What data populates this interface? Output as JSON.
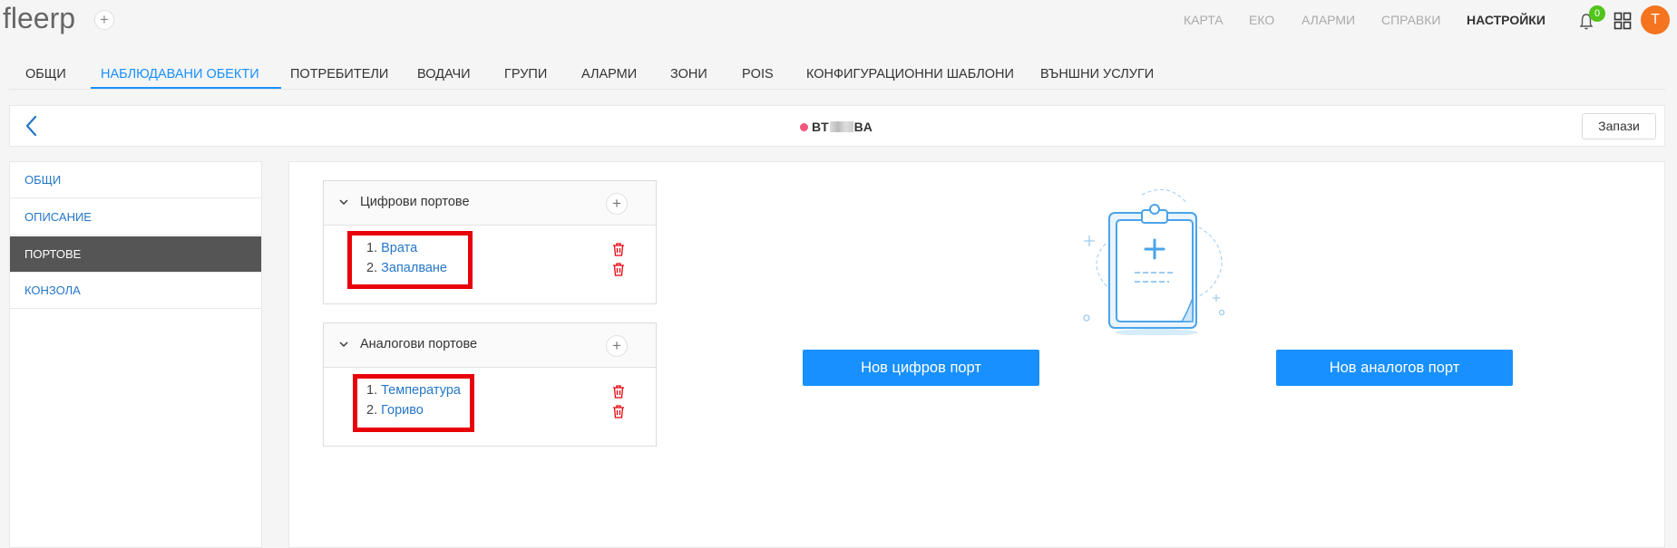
{
  "app": {
    "logo": "fleerp",
    "logo_add": "+"
  },
  "topnav": {
    "items": [
      {
        "label": "КАРТА"
      },
      {
        "label": "ЕКО"
      },
      {
        "label": "АЛАРМИ"
      },
      {
        "label": "СПРАВКИ"
      },
      {
        "label": "НАСТРОЙКИ"
      }
    ],
    "notifications_count": "0",
    "avatar_initial": "T"
  },
  "tabs": [
    {
      "label": "ОБЩИ"
    },
    {
      "label": "НАБЛЮДАВАНИ ОБЕКТИ"
    },
    {
      "label": "ПОТРЕБИТЕЛИ"
    },
    {
      "label": "ВОДАЧИ"
    },
    {
      "label": "ГРУПИ"
    },
    {
      "label": "АЛАРМИ"
    },
    {
      "label": "ЗОНИ"
    },
    {
      "label": "POIS"
    },
    {
      "label": "КОНФИГУРАЦИОННИ ШАБЛОНИ"
    },
    {
      "label": "ВЪНШНИ УСЛУГИ"
    }
  ],
  "header": {
    "title_prefix": "BT",
    "title_suffix": "BA",
    "status_color": "#f0577a",
    "save_label": "Запази"
  },
  "sidemenu": {
    "items": [
      {
        "label": "ОБЩИ"
      },
      {
        "label": "ОПИСАНИЕ"
      },
      {
        "label": "ПОРТОВЕ"
      },
      {
        "label": "КОНЗОЛА"
      }
    ]
  },
  "digital_ports": {
    "title": "Цифрови портове",
    "add": "+",
    "items": [
      {
        "index": "1.",
        "name": "Врата"
      },
      {
        "index": "2.",
        "name": "Запалване"
      }
    ]
  },
  "analog_ports": {
    "title": "Аналогови портове",
    "add": "+",
    "items": [
      {
        "index": "1.",
        "name": "Температура"
      },
      {
        "index": "2.",
        "name": "Гориво"
      }
    ]
  },
  "actions": {
    "new_digital": "Нов цифров порт",
    "new_analog": "Нов аналогов порт"
  },
  "colors": {
    "accent": "#1890ff",
    "link": "#2477c9",
    "highlight": "#e8000b",
    "delete": "#e8000b",
    "notif": "#52c41a",
    "avatar": "#f5741f"
  }
}
